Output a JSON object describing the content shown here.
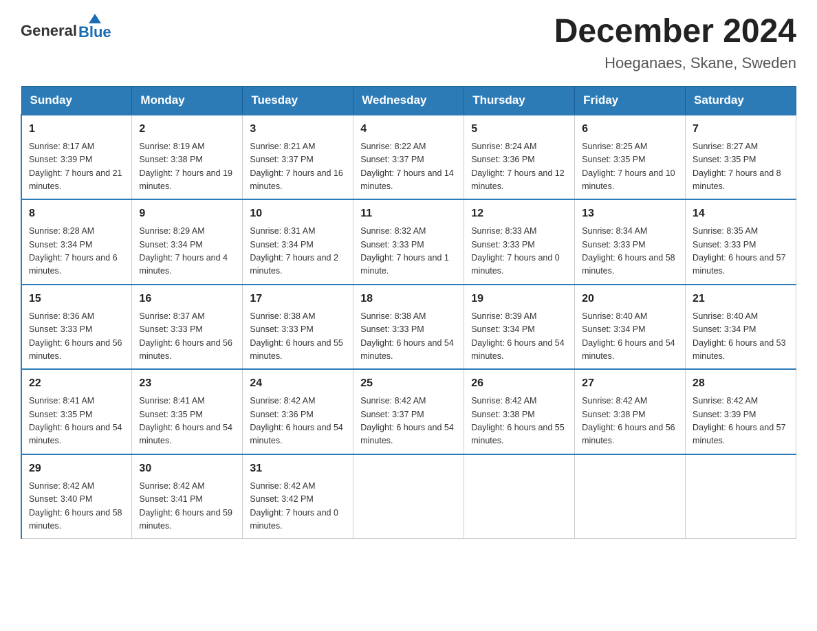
{
  "header": {
    "logo_general": "General",
    "logo_blue": "Blue",
    "month_title": "December 2024",
    "location": "Hoeganaes, Skane, Sweden"
  },
  "days_of_week": [
    "Sunday",
    "Monday",
    "Tuesday",
    "Wednesday",
    "Thursday",
    "Friday",
    "Saturday"
  ],
  "weeks": [
    [
      {
        "day": "1",
        "sunrise": "8:17 AM",
        "sunset": "3:39 PM",
        "daylight": "7 hours and 21 minutes."
      },
      {
        "day": "2",
        "sunrise": "8:19 AM",
        "sunset": "3:38 PM",
        "daylight": "7 hours and 19 minutes."
      },
      {
        "day": "3",
        "sunrise": "8:21 AM",
        "sunset": "3:37 PM",
        "daylight": "7 hours and 16 minutes."
      },
      {
        "day": "4",
        "sunrise": "8:22 AM",
        "sunset": "3:37 PM",
        "daylight": "7 hours and 14 minutes."
      },
      {
        "day": "5",
        "sunrise": "8:24 AM",
        "sunset": "3:36 PM",
        "daylight": "7 hours and 12 minutes."
      },
      {
        "day": "6",
        "sunrise": "8:25 AM",
        "sunset": "3:35 PM",
        "daylight": "7 hours and 10 minutes."
      },
      {
        "day": "7",
        "sunrise": "8:27 AM",
        "sunset": "3:35 PM",
        "daylight": "7 hours and 8 minutes."
      }
    ],
    [
      {
        "day": "8",
        "sunrise": "8:28 AM",
        "sunset": "3:34 PM",
        "daylight": "7 hours and 6 minutes."
      },
      {
        "day": "9",
        "sunrise": "8:29 AM",
        "sunset": "3:34 PM",
        "daylight": "7 hours and 4 minutes."
      },
      {
        "day": "10",
        "sunrise": "8:31 AM",
        "sunset": "3:34 PM",
        "daylight": "7 hours and 2 minutes."
      },
      {
        "day": "11",
        "sunrise": "8:32 AM",
        "sunset": "3:33 PM",
        "daylight": "7 hours and 1 minute."
      },
      {
        "day": "12",
        "sunrise": "8:33 AM",
        "sunset": "3:33 PM",
        "daylight": "7 hours and 0 minutes."
      },
      {
        "day": "13",
        "sunrise": "8:34 AM",
        "sunset": "3:33 PM",
        "daylight": "6 hours and 58 minutes."
      },
      {
        "day": "14",
        "sunrise": "8:35 AM",
        "sunset": "3:33 PM",
        "daylight": "6 hours and 57 minutes."
      }
    ],
    [
      {
        "day": "15",
        "sunrise": "8:36 AM",
        "sunset": "3:33 PM",
        "daylight": "6 hours and 56 minutes."
      },
      {
        "day": "16",
        "sunrise": "8:37 AM",
        "sunset": "3:33 PM",
        "daylight": "6 hours and 56 minutes."
      },
      {
        "day": "17",
        "sunrise": "8:38 AM",
        "sunset": "3:33 PM",
        "daylight": "6 hours and 55 minutes."
      },
      {
        "day": "18",
        "sunrise": "8:38 AM",
        "sunset": "3:33 PM",
        "daylight": "6 hours and 54 minutes."
      },
      {
        "day": "19",
        "sunrise": "8:39 AM",
        "sunset": "3:34 PM",
        "daylight": "6 hours and 54 minutes."
      },
      {
        "day": "20",
        "sunrise": "8:40 AM",
        "sunset": "3:34 PM",
        "daylight": "6 hours and 54 minutes."
      },
      {
        "day": "21",
        "sunrise": "8:40 AM",
        "sunset": "3:34 PM",
        "daylight": "6 hours and 53 minutes."
      }
    ],
    [
      {
        "day": "22",
        "sunrise": "8:41 AM",
        "sunset": "3:35 PM",
        "daylight": "6 hours and 54 minutes."
      },
      {
        "day": "23",
        "sunrise": "8:41 AM",
        "sunset": "3:35 PM",
        "daylight": "6 hours and 54 minutes."
      },
      {
        "day": "24",
        "sunrise": "8:42 AM",
        "sunset": "3:36 PM",
        "daylight": "6 hours and 54 minutes."
      },
      {
        "day": "25",
        "sunrise": "8:42 AM",
        "sunset": "3:37 PM",
        "daylight": "6 hours and 54 minutes."
      },
      {
        "day": "26",
        "sunrise": "8:42 AM",
        "sunset": "3:38 PM",
        "daylight": "6 hours and 55 minutes."
      },
      {
        "day": "27",
        "sunrise": "8:42 AM",
        "sunset": "3:38 PM",
        "daylight": "6 hours and 56 minutes."
      },
      {
        "day": "28",
        "sunrise": "8:42 AM",
        "sunset": "3:39 PM",
        "daylight": "6 hours and 57 minutes."
      }
    ],
    [
      {
        "day": "29",
        "sunrise": "8:42 AM",
        "sunset": "3:40 PM",
        "daylight": "6 hours and 58 minutes."
      },
      {
        "day": "30",
        "sunrise": "8:42 AM",
        "sunset": "3:41 PM",
        "daylight": "6 hours and 59 minutes."
      },
      {
        "day": "31",
        "sunrise": "8:42 AM",
        "sunset": "3:42 PM",
        "daylight": "7 hours and 0 minutes."
      },
      null,
      null,
      null,
      null
    ]
  ],
  "labels": {
    "sunrise": "Sunrise:",
    "sunset": "Sunset:",
    "daylight": "Daylight:"
  }
}
